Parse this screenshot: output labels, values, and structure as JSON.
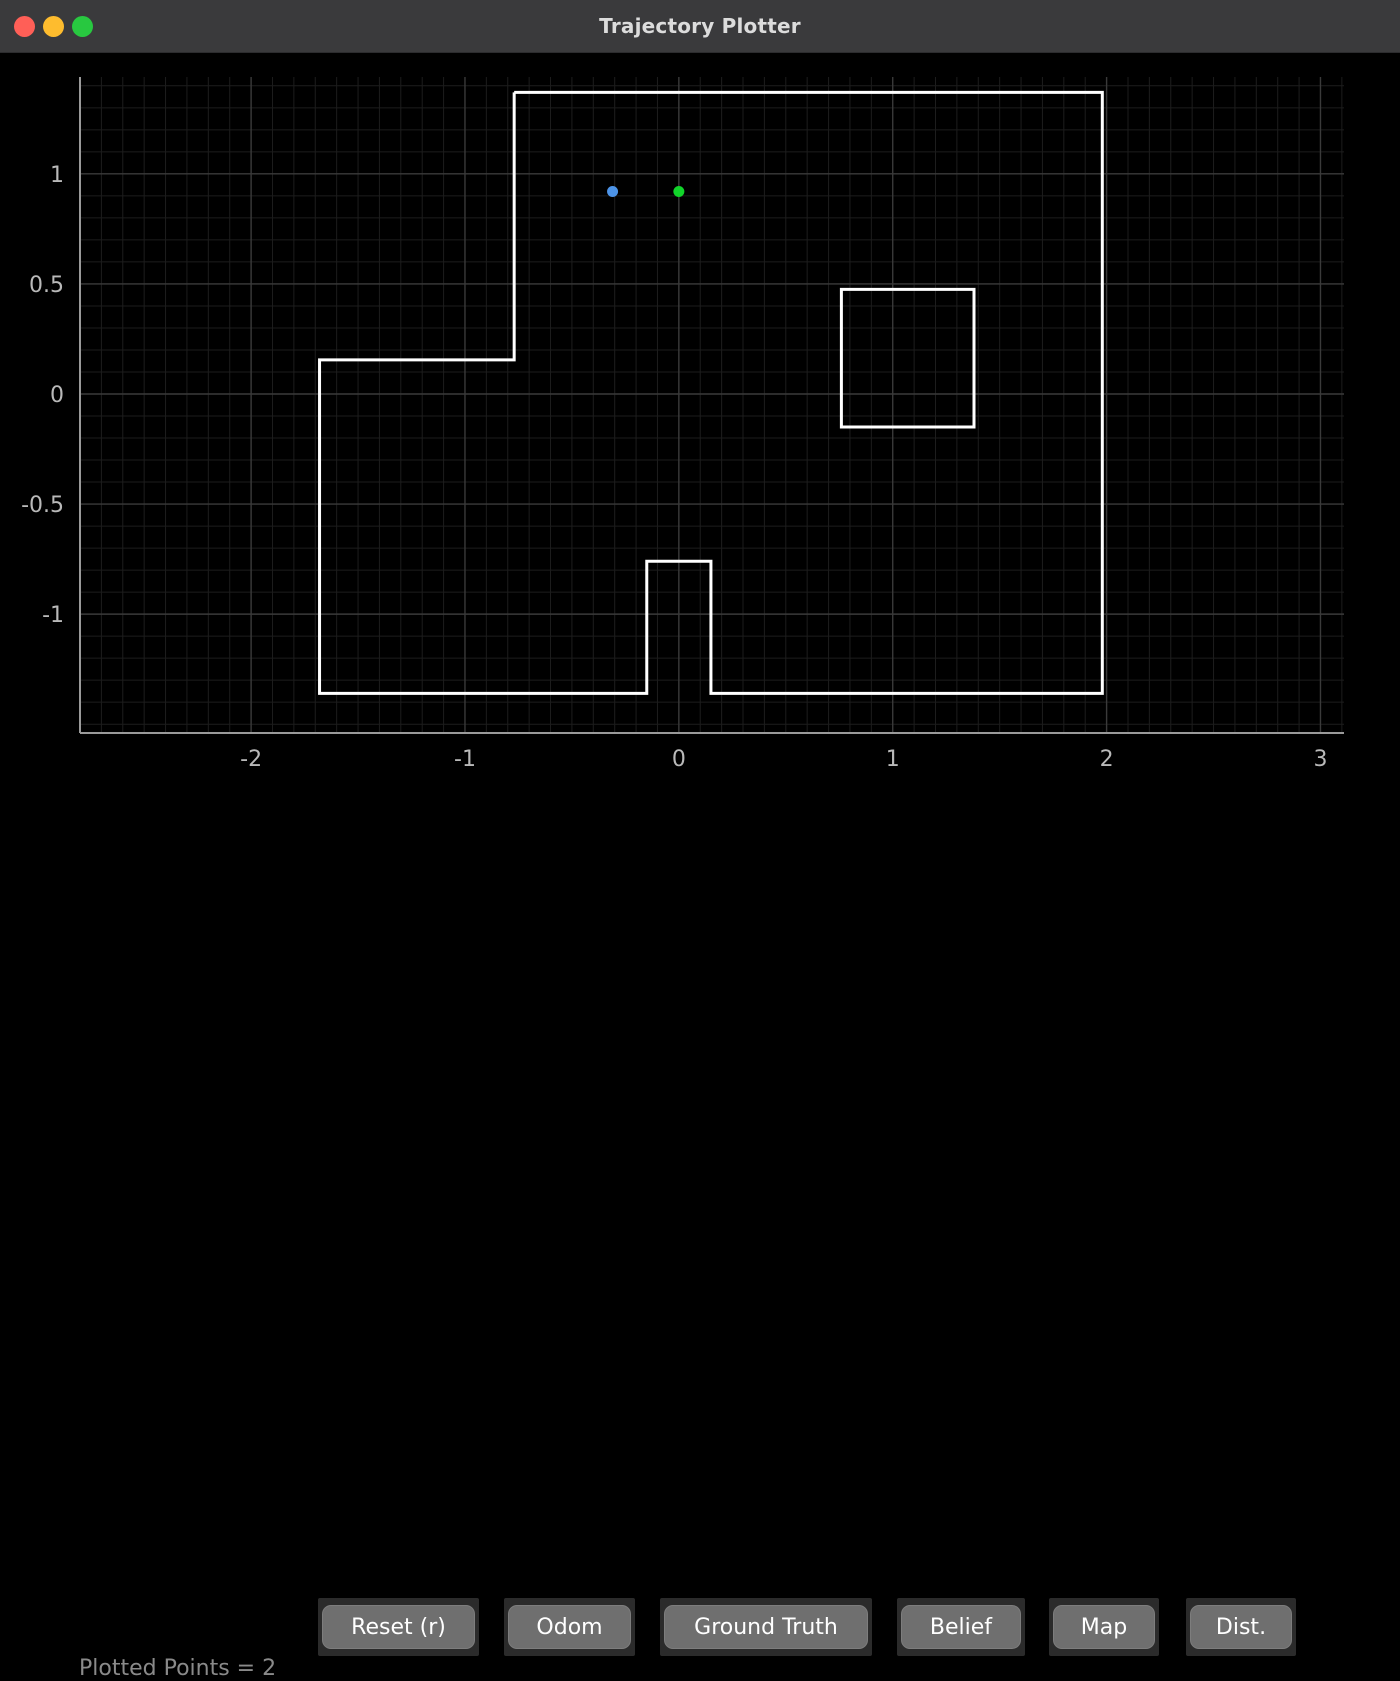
{
  "window": {
    "title": "Trajectory Plotter",
    "traffic_lights": [
      {
        "name": "close-button",
        "color": "#ff5f57"
      },
      {
        "name": "minimize-button",
        "color": "#febc2e"
      },
      {
        "name": "maximize-button",
        "color": "#28c840"
      }
    ]
  },
  "status": {
    "plotted_points_label": "Plotted Points = 2"
  },
  "toolbar": {
    "buttons": [
      {
        "id": "reset",
        "label": "Reset (r)"
      },
      {
        "id": "odom",
        "label": "Odom"
      },
      {
        "id": "ground-truth",
        "label": "Ground Truth"
      },
      {
        "id": "belief",
        "label": "Belief"
      },
      {
        "id": "map",
        "label": "Map"
      },
      {
        "id": "dist",
        "label": "Dist."
      }
    ]
  },
  "chart_data": {
    "type": "scatter",
    "title": "",
    "xlabel": "",
    "ylabel": "",
    "xlim": [
      -2.8,
      3.11
    ],
    "ylim": [
      -1.54,
      1.44
    ],
    "x_ticks": [
      -2,
      -1,
      0,
      1,
      2,
      3
    ],
    "y_ticks": [
      1,
      0.5,
      0,
      -0.5,
      -1
    ],
    "x_tick_labels": [
      "-2",
      "-1",
      "0",
      "1",
      "2",
      "3"
    ],
    "y_tick_labels": [
      "1",
      "0.5",
      "0",
      "-0.5",
      "-1"
    ],
    "grid": true,
    "minor_grid": true,
    "minor_grid_step": 0.1,
    "background": "#000000",
    "grid_color": "#3a3a3a",
    "minor_grid_color": "#1d1d1d",
    "axis_color": "#9a9a9a",
    "legend": "none",
    "series": [
      {
        "name": "belief",
        "type": "point",
        "color": "#4d94e8",
        "marker": "circle",
        "size": 11,
        "points": [
          [
            -0.31,
            0.92
          ]
        ]
      },
      {
        "name": "ground-truth",
        "type": "point",
        "color": "#11d42a",
        "marker": "circle",
        "size": 11,
        "points": [
          [
            0.0,
            0.92
          ]
        ]
      },
      {
        "name": "map-outline",
        "type": "polyline",
        "color": "#ffffff",
        "width": 3,
        "closed": false,
        "points": [
          [
            -0.77,
            1.37
          ],
          [
            1.98,
            1.37
          ],
          [
            1.98,
            -1.36
          ],
          [
            0.15,
            -1.36
          ],
          [
            0.15,
            -0.76
          ],
          [
            -0.15,
            -0.76
          ],
          [
            -0.15,
            -1.36
          ],
          [
            -1.68,
            -1.36
          ],
          [
            -1.68,
            0.155
          ],
          [
            -0.77,
            0.155
          ],
          [
            -0.77,
            1.37
          ]
        ]
      },
      {
        "name": "map-inner-box",
        "type": "polyline",
        "color": "#ffffff",
        "width": 3,
        "closed": true,
        "points": [
          [
            0.76,
            0.475
          ],
          [
            1.38,
            0.475
          ],
          [
            1.38,
            -0.15
          ],
          [
            0.76,
            -0.15
          ]
        ]
      }
    ]
  }
}
